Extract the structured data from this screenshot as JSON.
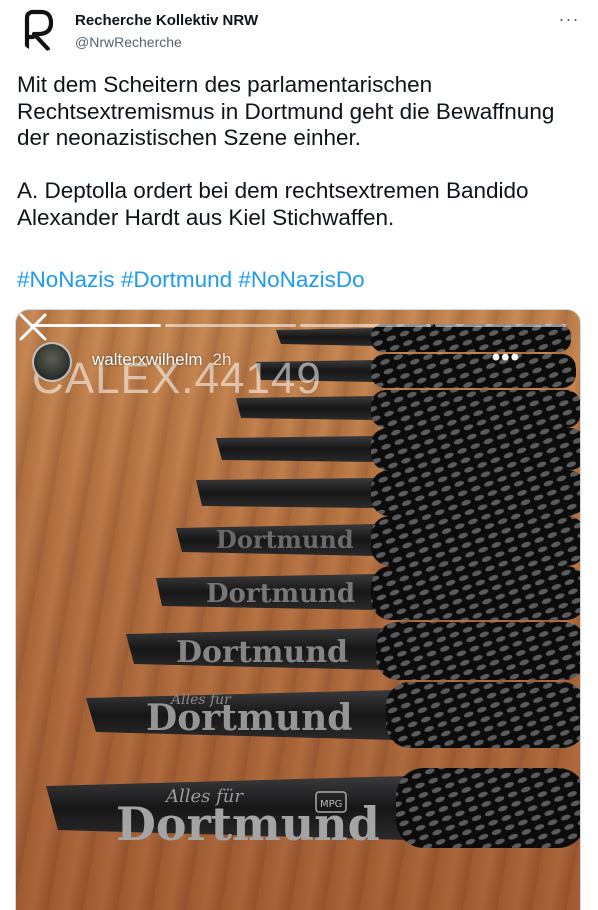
{
  "author": {
    "display_name": "Recherche Kollektiv NRW",
    "handle": "@NrwRecherche",
    "logo_letter": "R"
  },
  "menu": {
    "more_label": "···"
  },
  "tweet": {
    "paragraph1": "Mit dem Scheitern des parlamentarischen Rechtsextremismus in Dortmund geht die Bewaffnung der neonazistischen Szene einher.",
    "paragraph2": "A. Deptolla ordert bei dem rechtsextremen Bandido Alexander Hardt aus Kiel Stichwaffen.",
    "hashtags": [
      "#NoNazis",
      "#Dortmund",
      "#NoNazisDo"
    ]
  },
  "media": {
    "story_user": "walterxwilhelm",
    "story_time": "2h",
    "watermark": "CALEX.44149",
    "story_dots": "•••",
    "blade_texts": [
      "Alles für",
      "Dortmund",
      "MPG"
    ],
    "colors": {
      "wood": "#b87444",
      "blade": "#1c1c1e",
      "handle": "#0e0e10"
    }
  },
  "colors": {
    "link": "#1d9bf0",
    "secondary_text": "#536471",
    "text": "#0f1419"
  }
}
